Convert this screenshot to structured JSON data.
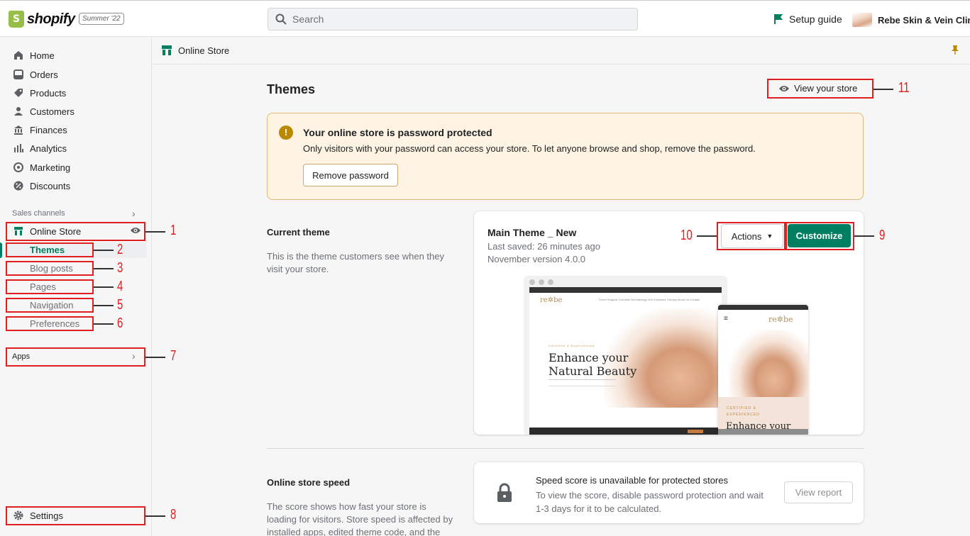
{
  "topbar": {
    "logo_text": "shopify",
    "edition_badge": "Summer '22",
    "search_placeholder": "Search",
    "setup_guide": "Setup guide",
    "store_name": "Rebe Skin & Vein Clinic"
  },
  "sidebar": {
    "items": [
      {
        "label": "Home",
        "icon": "home-icon"
      },
      {
        "label": "Orders",
        "icon": "inbox-icon"
      },
      {
        "label": "Products",
        "icon": "tag-icon"
      },
      {
        "label": "Customers",
        "icon": "person-icon"
      },
      {
        "label": "Finances",
        "icon": "bank-icon"
      },
      {
        "label": "Analytics",
        "icon": "bar-chart-icon"
      },
      {
        "label": "Marketing",
        "icon": "target-icon"
      },
      {
        "label": "Discounts",
        "icon": "discount-icon"
      }
    ],
    "sales_channels_label": "Sales channels",
    "online_store_label": "Online Store",
    "sub_items": [
      "Themes",
      "Blog posts",
      "Pages",
      "Navigation",
      "Preferences"
    ],
    "apps_label": "Apps",
    "settings_label": "Settings"
  },
  "annotations": [
    "1",
    "2",
    "3",
    "4",
    "5",
    "6",
    "7",
    "8",
    "9",
    "10",
    "11"
  ],
  "main": {
    "header_title": "Online Store",
    "page_title": "Themes",
    "view_store_label": "View your store",
    "banner": {
      "title": "Your online store is password protected",
      "text": "Only visitors with your password can access your store. To let anyone browse and shop, remove the password.",
      "button": "Remove password"
    },
    "current_theme": {
      "section_title": "Current theme",
      "section_desc_1": "This is the theme customers see when they",
      "section_desc_2": "visit your store.",
      "theme_name": "Main Theme _ New",
      "last_saved": "Last saved: 26 minutes ago",
      "version": "November version 4.0.0",
      "actions_label": "Actions",
      "customize_label": "Customize",
      "preview": {
        "desktop_logo": "re✲be",
        "desktop_menu": "Home   Surgical   Cosmetic   Dermatology   Vein Diseases Therapy   About Us   Contact",
        "desktop_cert": "Certified & Experienced",
        "desktop_hero_1": "Enhance your",
        "desktop_hero_2": "Natural Beauty",
        "mobile_logo": "re✲be",
        "mobile_cert": "CERTIFIED & EXPERIENCED",
        "mobile_hero": "Enhance your"
      }
    },
    "speed": {
      "section_title": "Online store speed",
      "section_desc_1": "The score shows how fast your store is",
      "section_desc_2": "loading for visitors. Store speed is affected by",
      "section_desc_3": "installed apps, edited theme code, and the",
      "card_title": "Speed score is unavailable for protected stores",
      "card_desc": "To view the score, disable password protection and wait 1-3 days for it to be calculated.",
      "view_report": "View report"
    }
  },
  "colors": {
    "accent_green": "#008060",
    "annotation_red": "#e02020",
    "banner_bg": "#fff4e4"
  }
}
